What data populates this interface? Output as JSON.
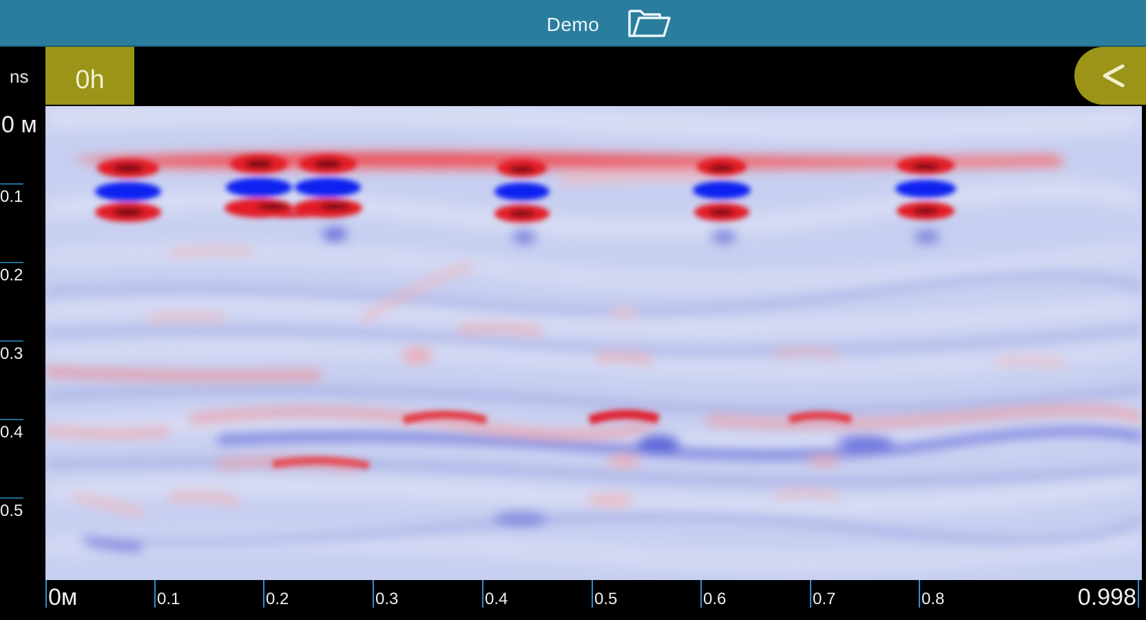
{
  "header": {
    "title": "Demo",
    "folder_icon": "folder-open-icon",
    "bg_color": "#2a7d9c"
  },
  "toolbar": {
    "unit_label": "ns",
    "hour_button_label": "0h",
    "back_button_label": "<",
    "button_color": "#9b9418"
  },
  "radargram": {
    "colormap": {
      "positive": "#ff0000",
      "zero": "#ffffff",
      "negative": "#0000ff",
      "background": "#c9d0f0"
    }
  },
  "y_axis": {
    "labels": [
      "0 м",
      "0.1",
      "0.2",
      "0.3",
      "0.4",
      "0.5"
    ],
    "values": [
      0,
      0.1,
      0.2,
      0.3,
      0.4,
      0.5
    ]
  },
  "x_axis": {
    "labels": [
      "0м",
      "0.1",
      "0.2",
      "0.3",
      "0.4",
      "0.5",
      "0.6",
      "0.7",
      "0.8",
      "0.998"
    ],
    "values": [
      0,
      0.1,
      0.2,
      0.3,
      0.4,
      0.5,
      0.6,
      0.7,
      0.8,
      0.998
    ]
  }
}
